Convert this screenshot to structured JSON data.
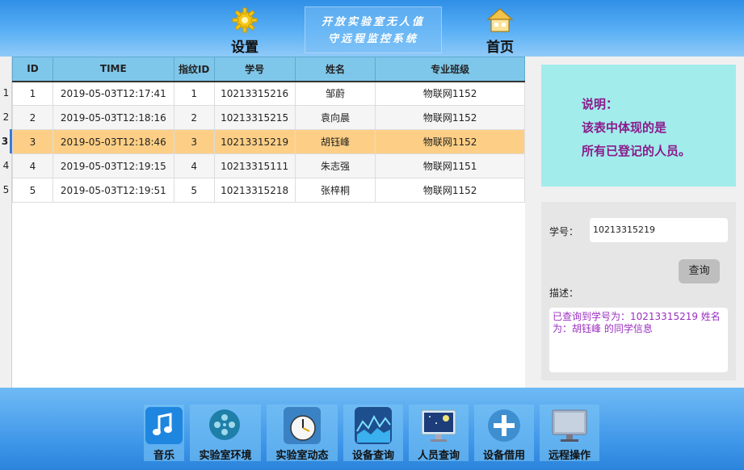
{
  "header": {
    "settings_label": "设置",
    "home_label": "首页",
    "title_line1": "开放实验室无人值",
    "title_line2": "守远程监控系统"
  },
  "table": {
    "columns": [
      "ID",
      "TIME",
      "指纹ID",
      "学号",
      "姓名",
      "专业班级"
    ],
    "row_numbers": [
      "1",
      "2",
      "3",
      "4",
      "5"
    ],
    "rows": [
      [
        "1",
        "2019-05-03T12:17:41",
        "1",
        "10213315216",
        "邹蔚",
        "物联网1152"
      ],
      [
        "2",
        "2019-05-03T12:18:16",
        "2",
        "10213315215",
        "袁向晨",
        "物联网1152"
      ],
      [
        "3",
        "2019-05-03T12:18:46",
        "3",
        "10213315219",
        "胡钰峰",
        "物联网1152"
      ],
      [
        "4",
        "2019-05-03T12:19:15",
        "4",
        "10213315111",
        "朱志强",
        "物联网1151"
      ],
      [
        "5",
        "2019-05-03T12:19:51",
        "5",
        "10213315218",
        "张梓桐",
        "物联网1152"
      ]
    ],
    "selected_row": 2
  },
  "info": {
    "line1": "说明：",
    "line2": "该表中体现的是",
    "line3": "所有已登记的人员。"
  },
  "search": {
    "id_label": "学号：",
    "id_value": "10213315219",
    "query_button": "查询",
    "desc_label": "描述：",
    "desc_text": "已查询到学号为：10213315219  姓名为：胡钰峰 的同学信息"
  },
  "footer": {
    "buttons": [
      "音乐",
      "实验室环境",
      "实验室动态",
      "设备查询",
      "人员查询",
      "设备借用",
      "远程操作"
    ],
    "icons": [
      "music-icon",
      "film-reel-icon",
      "clock-icon",
      "chart-icon",
      "monitor-night-icon",
      "plus-icon",
      "screen-icon"
    ]
  },
  "colors": {
    "header_blue": "#3d95e8",
    "selected_row": "#fdcf86",
    "info_bg": "#a2ecec",
    "info_text": "#8b1a8b",
    "desc_text": "#9a2fc0"
  }
}
